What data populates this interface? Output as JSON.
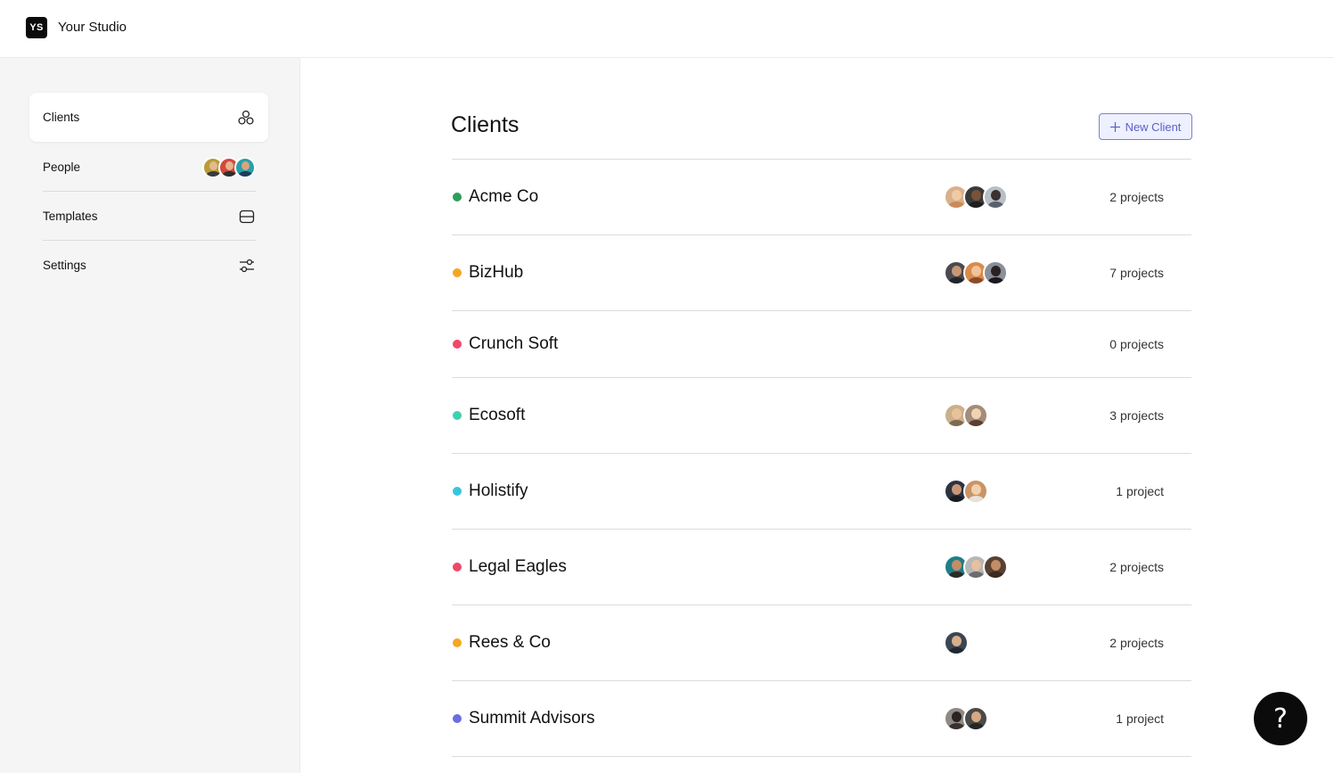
{
  "app": {
    "logo_text": "YS",
    "studio_name": "Your Studio"
  },
  "sidebar": {
    "items": [
      {
        "label": "Clients",
        "icon": "clients-icon"
      },
      {
        "label": "People",
        "icon": "avatar-stack"
      },
      {
        "label": "Templates",
        "icon": "templates-icon"
      },
      {
        "label": "Settings",
        "icon": "settings-icon"
      }
    ]
  },
  "main": {
    "title": "Clients",
    "new_button_label": "New Client",
    "clients": [
      {
        "name": "Acme Co",
        "status_color": "#2e9e5b",
        "projects": "2 projects"
      },
      {
        "name": "BizHub",
        "status_color": "#f5a623",
        "projects": "7 projects"
      },
      {
        "name": "Crunch Soft",
        "status_color": "#f0476a",
        "projects": "0 projects"
      },
      {
        "name": "Ecosoft",
        "status_color": "#3fd0b0",
        "projects": "3 projects"
      },
      {
        "name": "Holistify",
        "status_color": "#35c6dd",
        "projects": "1 project"
      },
      {
        "name": "Legal Eagles",
        "status_color": "#f0476a",
        "projects": "2 projects"
      },
      {
        "name": "Rees & Co",
        "status_color": "#f5a623",
        "projects": "2 projects"
      },
      {
        "name": "Summit Advisors",
        "status_color": "#6b6ee0",
        "projects": "1 project"
      }
    ]
  },
  "help": {
    "label": "?"
  }
}
